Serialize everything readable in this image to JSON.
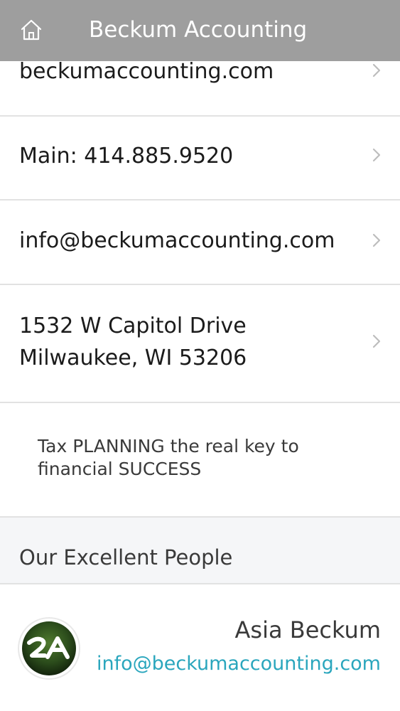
{
  "header": {
    "title": "Beckum Accounting",
    "home_icon": "home-icon"
  },
  "contact_rows": [
    {
      "label": "beckumaccounting.com"
    },
    {
      "label": "Main: 414.885.9520"
    },
    {
      "label": "info@beckumaccounting.com"
    },
    {
      "line1": "1532 W Capitol Drive",
      "line2": "Milwaukee, WI 53206"
    }
  ],
  "tagline": {
    "line1": "Tax PLANNING the real key to",
    "line2": "financial SUCCESS"
  },
  "people_section": {
    "title": "Our Excellent People",
    "people": [
      {
        "name": "Asia Beckum",
        "email": "info@beckumaccounting.com",
        "avatar_icon": "2a-logo-icon"
      }
    ]
  },
  "colors": {
    "header_bg": "#9e9e9e",
    "header_text": "#ffffff",
    "link": "#2aa6bd",
    "divider": "#e2e2e2",
    "section_bg": "#f5f6f8"
  }
}
